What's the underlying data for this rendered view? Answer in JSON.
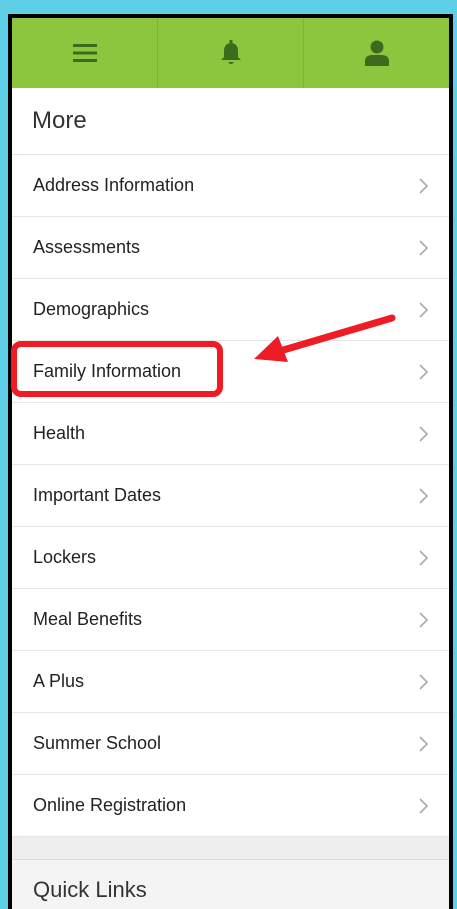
{
  "topbar": {
    "icons": [
      "menu-icon",
      "bell-icon",
      "user-icon"
    ],
    "color": "#8cc63f"
  },
  "section_title": "More",
  "items": [
    {
      "label": "Address Information"
    },
    {
      "label": "Assessments"
    },
    {
      "label": "Demographics"
    },
    {
      "label": "Family Information"
    },
    {
      "label": "Health"
    },
    {
      "label": "Important Dates"
    },
    {
      "label": "Lockers"
    },
    {
      "label": "Meal Benefits"
    },
    {
      "label": "A Plus"
    },
    {
      "label": "Summer School"
    },
    {
      "label": "Online Registration"
    }
  ],
  "quick_links_title": "Quick Links",
  "annotation": {
    "highlighted_item": "Family Information",
    "color": "#ee1c24"
  }
}
